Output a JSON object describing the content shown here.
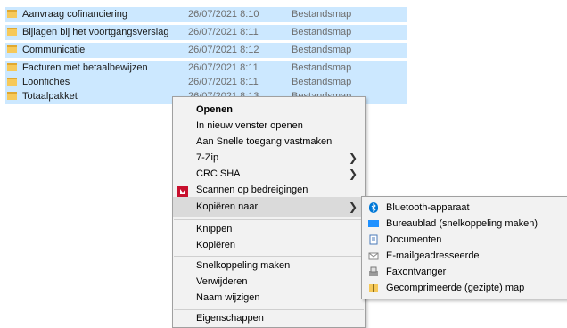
{
  "files": [
    {
      "name": "Aanvraag cofinanciering",
      "date": "26/07/2021 8:10",
      "type": "Bestandsmap"
    },
    {
      "name": "Bijlagen bij het voortgangsverslag",
      "date": "26/07/2021 8:11",
      "type": "Bestandsmap"
    },
    {
      "name": "Communicatie",
      "date": "26/07/2021 8:12",
      "type": "Bestandsmap"
    },
    {
      "name": "Facturen met betaalbewijzen",
      "date": "26/07/2021 8:11",
      "type": "Bestandsmap"
    },
    {
      "name": "Loonfiches",
      "date": "26/07/2021 8:11",
      "type": "Bestandsmap"
    },
    {
      "name": "Totaalpakket",
      "date": "26/07/2021 8:13",
      "type": "Bestandsmap"
    }
  ],
  "context_menu": {
    "open": "Openen",
    "open_new_window": "In nieuw venster openen",
    "pin_quick_access": "Aan Snelle toegang vastmaken",
    "zip7": "7-Zip",
    "crc_sha": "CRC SHA",
    "scan_threats": "Scannen op bedreigingen",
    "copy_to": "Kopiëren naar",
    "cut": "Knippen",
    "copy": "Kopiëren",
    "create_shortcut": "Snelkoppeling maken",
    "delete": "Verwijderen",
    "rename": "Naam wijzigen",
    "properties": "Eigenschappen"
  },
  "submenu": {
    "bluetooth": "Bluetooth-apparaat",
    "desktop": "Bureaublad (snelkoppeling maken)",
    "documents": "Documenten",
    "mail_recipient": "E-mailgeadresseerde",
    "fax_recipient": "Faxontvanger",
    "zip_folder": "Gecomprimeerde (gezipte) map"
  },
  "colors": {
    "selection": "#cce8ff",
    "menu_bg": "#f2f2f2",
    "hover": "#dadada",
    "mcafee_red": "#c8102e",
    "bluetooth_blue": "#0078d7"
  }
}
